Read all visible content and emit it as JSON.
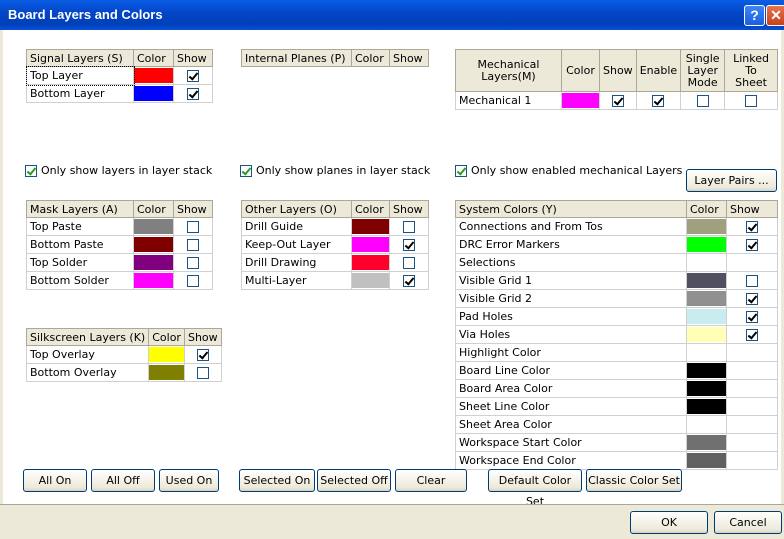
{
  "title": "Board Layers and Colors",
  "signal": {
    "header": [
      "Signal Layers (S)",
      "Color",
      "Show"
    ],
    "rows": [
      {
        "name": "Top Layer",
        "color": "#ff0000",
        "show": true
      },
      {
        "name": "Bottom Layer",
        "color": "#0000ff",
        "show": true
      }
    ]
  },
  "internal": {
    "header": [
      "Internal Planes (P)",
      "Color",
      "Show"
    ]
  },
  "mech": {
    "header": [
      "Mechanical Layers(M)",
      "Color",
      "Show",
      "Enable",
      "Single Layer Mode",
      "Linked To Sheet"
    ],
    "rows": [
      {
        "name": "Mechanical 1",
        "color": "#ff00ff",
        "show": true,
        "enable": true,
        "single": false,
        "linked": false
      }
    ]
  },
  "options": {
    "signal": "Only show layers in layer stack",
    "planes": "Only show planes in layer stack",
    "mech": "Only show enabled mechanical Layers"
  },
  "layer_pairs": "Layer Pairs ...",
  "mask": {
    "header": [
      "Mask Layers (A)",
      "Color",
      "Show"
    ],
    "rows": [
      {
        "name": "Top Paste",
        "color": "#808080",
        "show": false
      },
      {
        "name": "Bottom Paste",
        "color": "#800000",
        "show": false
      },
      {
        "name": "Top Solder",
        "color": "#800080",
        "show": false
      },
      {
        "name": "Bottom Solder",
        "color": "#ff00ff",
        "show": false
      }
    ]
  },
  "other": {
    "header": [
      "Other Layers (O)",
      "Color",
      "Show"
    ],
    "rows": [
      {
        "name": "Drill Guide",
        "color": "#800000",
        "show": false
      },
      {
        "name": "Keep-Out Layer",
        "color": "#ff00ff",
        "show": true
      },
      {
        "name": "Drill Drawing",
        "color": "#ff002a",
        "show": false
      },
      {
        "name": "Multi-Layer",
        "color": "#c0c0c0",
        "show": true
      }
    ]
  },
  "silk": {
    "header": [
      "Silkscreen Layers (K)",
      "Color",
      "Show"
    ],
    "rows": [
      {
        "name": "Top Overlay",
        "color": "#ffff00",
        "show": true
      },
      {
        "name": "Bottom Overlay",
        "color": "#808000",
        "show": false
      }
    ]
  },
  "system": {
    "header": [
      "System Colors (Y)",
      "Color",
      "Show"
    ],
    "rows": [
      {
        "name": "Connections and From Tos",
        "color": "#a0a080",
        "show": true,
        "has_check": true
      },
      {
        "name": "DRC Error Markers",
        "color": "#00ff00",
        "show": true,
        "has_check": true
      },
      {
        "name": "Selections",
        "color": "#ffffff",
        "show": false,
        "has_check": false
      },
      {
        "name": "Visible Grid 1",
        "color": "#505060",
        "show": false,
        "has_check": true
      },
      {
        "name": "Visible Grid 2",
        "color": "#909090",
        "show": true,
        "has_check": true
      },
      {
        "name": "Pad Holes",
        "color": "#c8ecf0",
        "show": true,
        "has_check": true
      },
      {
        "name": "Via Holes",
        "color": "#ffffb8",
        "show": true,
        "has_check": true
      },
      {
        "name": "Highlight Color",
        "color": "#ffffff",
        "show": false,
        "has_check": false
      },
      {
        "name": "Board Line Color",
        "color": "#000000",
        "show": false,
        "has_check": false
      },
      {
        "name": "Board Area Color",
        "color": "#000000",
        "show": false,
        "has_check": false
      },
      {
        "name": "Sheet Line Color",
        "color": "#000000",
        "show": false,
        "has_check": false
      },
      {
        "name": "Sheet Area Color",
        "color": "#ffffff",
        "show": false,
        "has_check": false
      },
      {
        "name": "Workspace Start Color",
        "color": "#707070",
        "show": false,
        "has_check": false
      },
      {
        "name": "Workspace End Color",
        "color": "#606060",
        "show": false,
        "has_check": false
      }
    ]
  },
  "buttons": {
    "all_on": "All On",
    "all_off": "All Off",
    "used_on": "Used On",
    "selected_on": "Selected On",
    "selected_off": "Selected Off",
    "clear": "Clear",
    "default_set": "Default Color Set",
    "classic_set": "Classic Color Set",
    "ok": "OK",
    "cancel": "Cancel"
  }
}
